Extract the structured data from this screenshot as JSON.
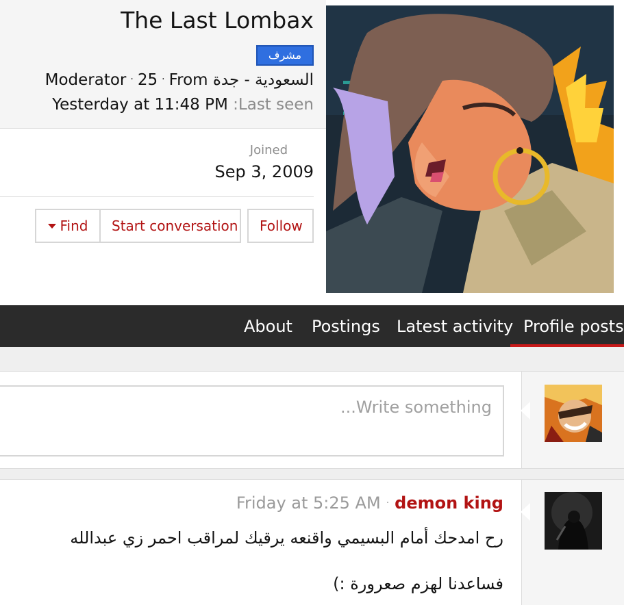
{
  "profile": {
    "username": "The Last Lombax",
    "badge": "مشرف",
    "role": "Moderator",
    "age": "25",
    "from_label": "From",
    "location": "السعودية - جدة",
    "last_seen_label": ":Last seen",
    "last_seen_value": "Yesterday at 11:48 PM",
    "joined_label": "Joined",
    "joined_value": "Sep 3, 2009"
  },
  "actions": {
    "find": "Find",
    "start_conversation": "Start conversation",
    "follow": "Follow"
  },
  "tabs": [
    {
      "label": "About",
      "active": false
    },
    {
      "label": "Postings",
      "active": false
    },
    {
      "label": "Latest activity",
      "active": false
    },
    {
      "label": "Profile posts",
      "active": true
    }
  ],
  "composer": {
    "placeholder": "...Write something"
  },
  "post": {
    "author": "demon king",
    "time": "Friday at 5:25 AM",
    "separator": "·",
    "line1": "رح امدحك أمام البسيمي واقنعه يرقيك لمراقب احمر زي عبدالله",
    "line2": "فساعدنا لهزم صعرورة :)"
  },
  "colors": {
    "accent": "#b21313",
    "badge": "#2f6fe0",
    "tabbar": "#2b2b2b",
    "tab_active_underline": "#c81919"
  }
}
